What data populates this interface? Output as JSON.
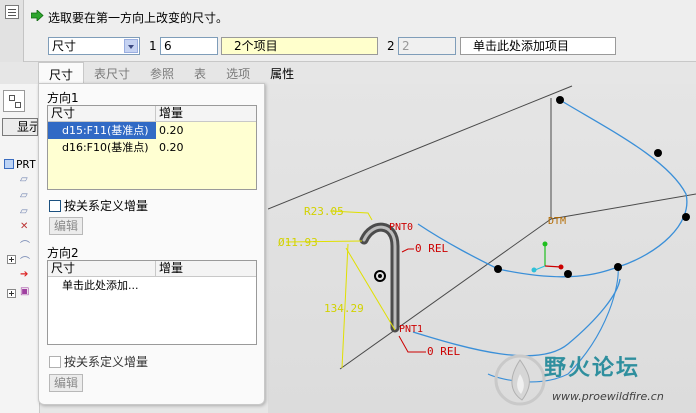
{
  "dashboard": {
    "prompt": "选取要在第一方向上改变的尺寸。",
    "type_select": "尺寸",
    "dir1_number": "1",
    "dir1_count": "6",
    "dir1_items": "2个项目",
    "dir2_number": "2",
    "dir2_count": "2",
    "dir2_items": "单击此处添加项目"
  },
  "tabs": [
    {
      "label": "尺寸",
      "state": "active"
    },
    {
      "label": "表尺寸",
      "state": "inactive"
    },
    {
      "label": "参照",
      "state": "inactive"
    },
    {
      "label": "表",
      "state": "inactive"
    },
    {
      "label": "选项",
      "state": "inactive"
    },
    {
      "label": "属性",
      "state": "enabled"
    }
  ],
  "tree": {
    "show_button": "显示",
    "root": "PRT"
  },
  "panel": {
    "dir1": {
      "title": "方向1",
      "col_dim": "尺寸",
      "col_inc": "增量",
      "rows": [
        {
          "dim": "d15:F11(基准点)",
          "inc": "0.20",
          "selected": true
        },
        {
          "dim": "d16:F10(基准点)",
          "inc": "0.20",
          "selected": false
        }
      ],
      "checkbox": "按关系定义增量",
      "edit": "编辑"
    },
    "dir2": {
      "title": "方向2",
      "col_dim": "尺寸",
      "col_inc": "增量",
      "placeholder": "单击此处添加...",
      "checkbox": "按关系定义增量",
      "edit": "编辑"
    }
  },
  "model": {
    "label_r": "R23.05",
    "label_dia": "Ø11.93",
    "label_len": "134.29",
    "label_pnt0": "PNT0",
    "label_pnt1": "PNT1",
    "label_rel0": "0 REL",
    "label_rel1": "0 REL",
    "label_dtm": "DTM"
  },
  "watermark": {
    "title": "野火论坛",
    "url": "www.proewildfire.cn"
  },
  "colors": {
    "dimension": "#e0e000",
    "annotation_red": "#cc0000",
    "datum": "#b36a00",
    "curve_blue": "#3a8fd8",
    "selection": "#316ac5"
  }
}
